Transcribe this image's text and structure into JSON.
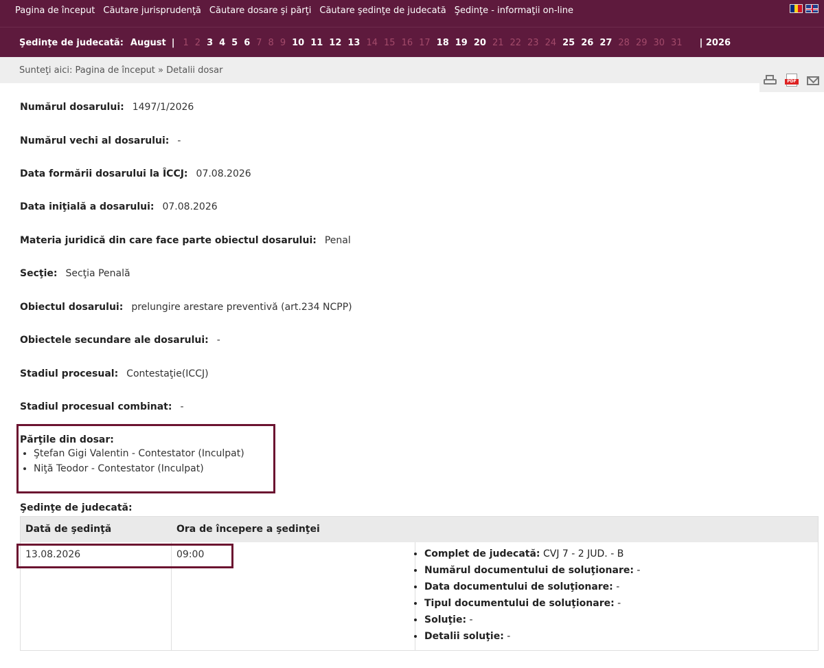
{
  "menu": [
    "Pagina de început",
    "Căutare jurisprudenţă",
    "Căutare dosare şi părţi",
    "Căutare şedinţe de judecată",
    "Şedinţe - informaţii on-line"
  ],
  "sedinte_bar": {
    "label": "Şedinţe de judecată:",
    "month": "August",
    "pipe": "|",
    "days": [
      {
        "n": "1",
        "active": false
      },
      {
        "n": "2",
        "active": false
      },
      {
        "n": "3",
        "active": true
      },
      {
        "n": "4",
        "active": true
      },
      {
        "n": "5",
        "active": true
      },
      {
        "n": "6",
        "active": true
      },
      {
        "n": "7",
        "active": false
      },
      {
        "n": "8",
        "active": false
      },
      {
        "n": "9",
        "active": false
      },
      {
        "n": "10",
        "active": true
      },
      {
        "n": "11",
        "active": true
      },
      {
        "n": "12",
        "active": true
      },
      {
        "n": "13",
        "active": true
      },
      {
        "n": "14",
        "active": false
      },
      {
        "n": "15",
        "active": false
      },
      {
        "n": "16",
        "active": false
      },
      {
        "n": "17",
        "active": false
      },
      {
        "n": "18",
        "active": true
      },
      {
        "n": "19",
        "active": true
      },
      {
        "n": "20",
        "active": true
      },
      {
        "n": "21",
        "active": false
      },
      {
        "n": "22",
        "active": false
      },
      {
        "n": "23",
        "active": false
      },
      {
        "n": "24",
        "active": false
      },
      {
        "n": "25",
        "active": true
      },
      {
        "n": "26",
        "active": true
      },
      {
        "n": "27",
        "active": true
      },
      {
        "n": "28",
        "active": false
      },
      {
        "n": "29",
        "active": false
      },
      {
        "n": "30",
        "active": false
      },
      {
        "n": "31",
        "active": false
      }
    ],
    "year": "| 2026"
  },
  "breadcrumb": "Sunteţi aici: Pagina de început » Detalii dosar",
  "fields": [
    {
      "label": "Numărul dosarului:",
      "value": "1497/1/2026"
    },
    {
      "label": "Numărul vechi al dosarului:",
      "value": "-"
    },
    {
      "label": "Data formării dosarului la ÎCCJ:",
      "value": "07.08.2026"
    },
    {
      "label": "Data iniţială a dosarului:",
      "value": "07.08.2026"
    },
    {
      "label": "Materia juridică din care face parte obiectul dosarului:",
      "value": "Penal"
    },
    {
      "label": "Secţie:",
      "value": "Secţia Penală"
    },
    {
      "label": "Obiectul dosarului:",
      "value": "prelungire arestare preventivă (art.234 NCPP)"
    },
    {
      "label": "Obiectele secundare ale dosarului:",
      "value": "-"
    },
    {
      "label": "Stadiul procesual:",
      "value": "Contestaţie(ICCJ)"
    },
    {
      "label": "Stadiul procesual combinat:",
      "value": "-"
    }
  ],
  "parties": {
    "label": "Părţile din dosar:",
    "items": [
      "Ştefan Gigi Valentin - Contestator (Inculpat)",
      "Niţă Teodor - Contestator (Inculpat)"
    ]
  },
  "sedinte": {
    "title": "Şedinţe de judecată:",
    "headers": [
      "Dată de şedinţă",
      "Ora de începere a şedinţei"
    ],
    "row": {
      "date": "13.08.2026",
      "time": "09:00",
      "details": [
        {
          "label": "Complet de judecată:",
          "value": "CVJ 7 - 2 JUD. - B"
        },
        {
          "label": "Numărul documentului de soluţionare:",
          "value": "-"
        },
        {
          "label": "Data documentului de soluţionare:",
          "value": "-"
        },
        {
          "label": "Tipul documentului de soluţionare:",
          "value": "-"
        },
        {
          "label": "Soluţie:",
          "value": "-"
        },
        {
          "label": "Detalii soluţie:",
          "value": "-"
        }
      ]
    }
  },
  "colors": {
    "header_bg": "#5e1a3d",
    "highlight_border": "#6b1330",
    "inactive_day": "#a24a6a"
  },
  "icons": [
    "print-icon",
    "pdf-icon",
    "email-icon",
    "flag-ro-icon",
    "flag-uk-icon"
  ]
}
